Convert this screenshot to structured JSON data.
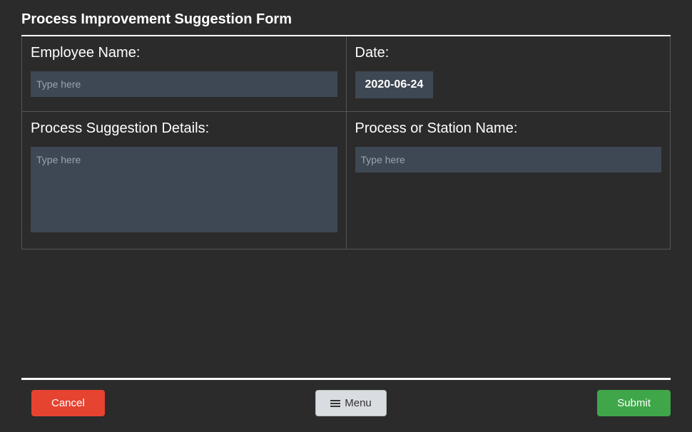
{
  "title": "Process Improvement Suggestion Form",
  "fields": {
    "employee_name": {
      "label": "Employee Name:",
      "placeholder": "Type here",
      "value": ""
    },
    "date": {
      "label": "Date:",
      "value": "2020-06-24"
    },
    "details": {
      "label": "Process Suggestion Details:",
      "placeholder": "Type here",
      "value": ""
    },
    "process_name": {
      "label": "Process or Station Name:",
      "placeholder": "Type here",
      "value": ""
    }
  },
  "footer": {
    "cancel": "Cancel",
    "menu": "Menu",
    "submit": "Submit"
  }
}
